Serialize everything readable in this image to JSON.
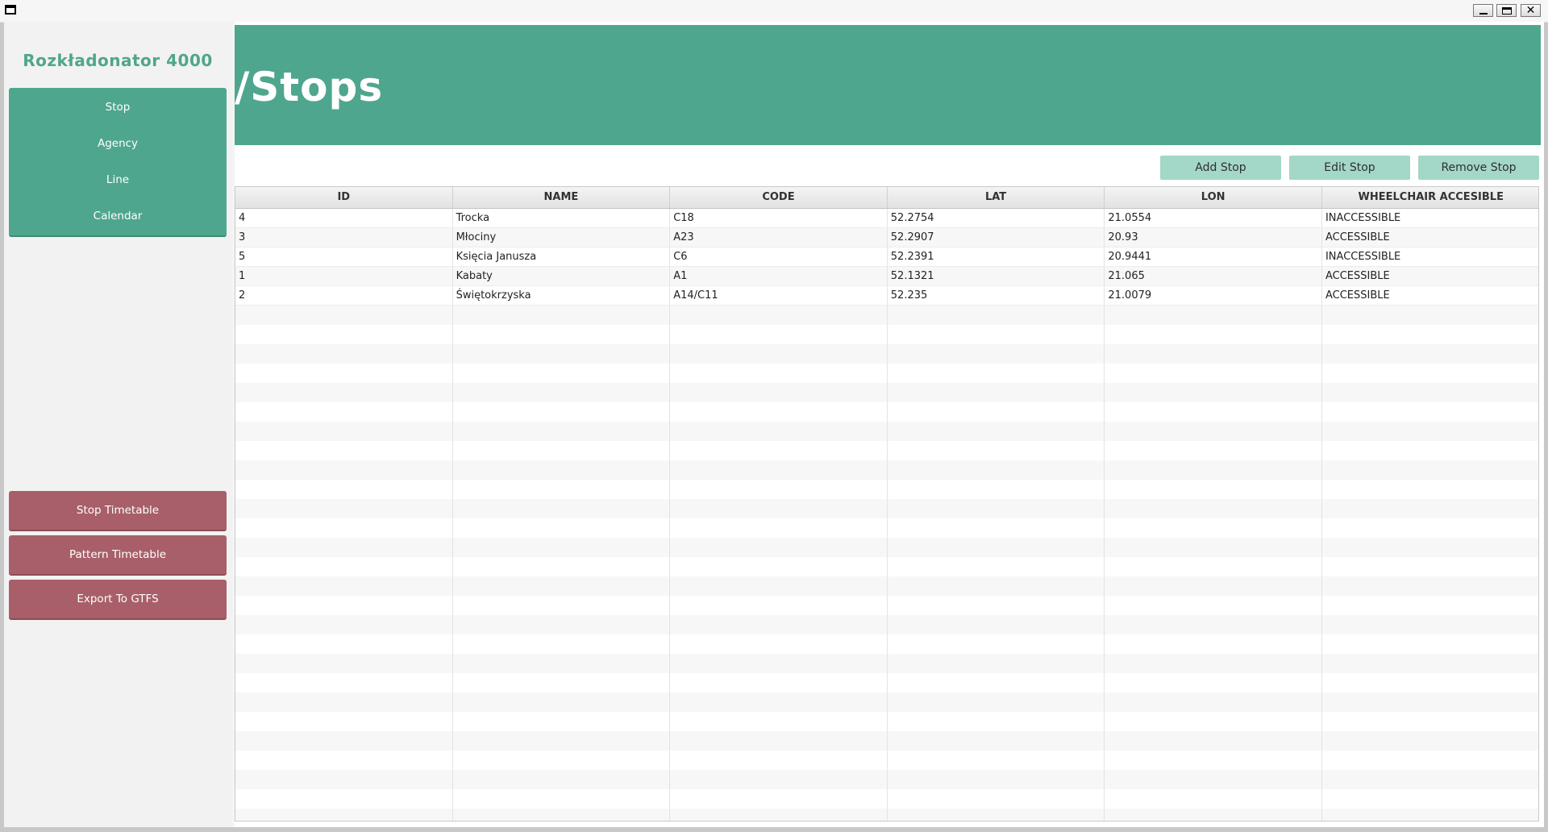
{
  "window": {
    "buttons": {
      "minimize": "minimize-icon",
      "maximize": "maximize-icon",
      "close": "close-icon"
    }
  },
  "sidebar": {
    "brand": "Rozkładonator 4000",
    "nav": [
      {
        "label": "Stop"
      },
      {
        "label": "Agency"
      },
      {
        "label": "Line"
      },
      {
        "label": "Calendar"
      }
    ],
    "actions": [
      {
        "label": "Stop Timetable"
      },
      {
        "label": "Pattern Timetable"
      },
      {
        "label": "Export To GTFS"
      }
    ]
  },
  "header": {
    "title": "/Stops"
  },
  "toolbar": {
    "add_label": "Add Stop",
    "edit_label": "Edit Stop",
    "remove_label": "Remove Stop"
  },
  "table": {
    "columns": [
      "ID",
      "NAME",
      "CODE",
      "LAT",
      "LON",
      "WHEELCHAIR ACCESIBLE"
    ],
    "rows": [
      [
        "4",
        "Trocka",
        "C18",
        "52.2754",
        "21.0554",
        "INACCESSIBLE"
      ],
      [
        "3",
        "Młociny",
        "A23",
        "52.2907",
        "20.93",
        "ACCESSIBLE"
      ],
      [
        "5",
        "Księcia Janusza",
        "C6",
        "52.2391",
        "20.9441",
        "INACCESSIBLE"
      ],
      [
        "1",
        "Kabaty",
        "A1",
        "52.1321",
        "21.065",
        "ACCESSIBLE"
      ],
      [
        "2",
        "Świętokrzyska",
        "A14/C11",
        "52.235",
        "21.0079",
        "ACCESSIBLE"
      ]
    ]
  },
  "colors": {
    "accent_green": "#4fa68e",
    "accent_red": "#a85f69",
    "toolbar_button": "#a3d7c7"
  }
}
